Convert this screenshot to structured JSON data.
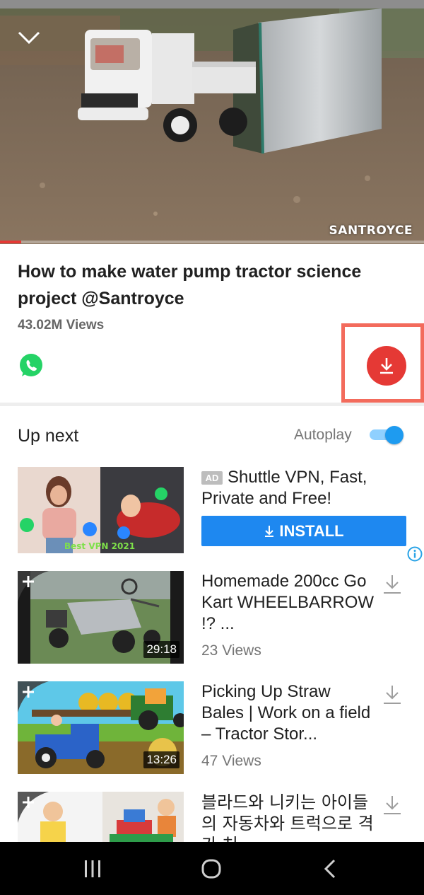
{
  "player": {
    "watermark": "SANTROYCE",
    "progress_fraction": 0.05,
    "collapse_icon": "chevron-down-icon"
  },
  "video": {
    "title": "How to make water pump tractor science project @Santroyce",
    "views": "43.02M Views",
    "share_icon": "whatsapp-icon",
    "download_icon": "download-icon"
  },
  "up_next": {
    "heading": "Up next",
    "autoplay_label": "Autoplay",
    "autoplay_on": true
  },
  "ad": {
    "badge": "AD",
    "title": "Shuttle VPN, Fast, Private and Free!",
    "thumb_text": "Best VPN 2021",
    "install_label": "INSTALL"
  },
  "videos": [
    {
      "title": "Homemade 200cc Go Kart WHEELBARROW !? ...",
      "views": "23 Views",
      "duration": "29:18"
    },
    {
      "title": "Picking Up Straw Bales | Work on a field – Tractor Stor...",
      "views": "47 Views",
      "duration": "13:26"
    },
    {
      "title": "블라드와 니키는 아이들의 자동차와 트럭으로 격가 처",
      "views": "",
      "duration": ""
    }
  ],
  "colors": {
    "accent_red": "#e53935",
    "install_blue": "#1e88f0",
    "toggle_blue": "#1e9bf0",
    "highlight": "#f36b5c"
  }
}
